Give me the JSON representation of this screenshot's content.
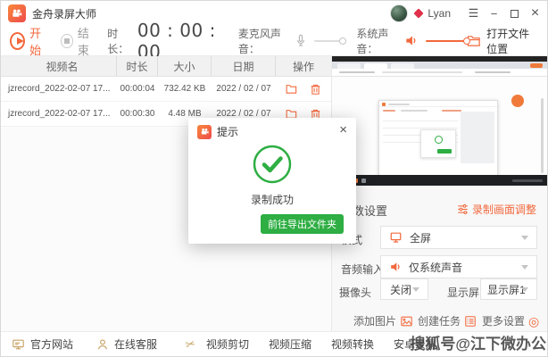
{
  "window": {
    "title": "金舟录屏大师"
  },
  "account": {
    "name": "Lyan"
  },
  "colors": {
    "accent": "#f2683c",
    "green": "#2eae43"
  },
  "toolbar": {
    "start_label": "开始",
    "stop_label": "结束",
    "duration_label": "时长：",
    "timer": "00 : 00 : 00",
    "mic_label": "麦克风声音：",
    "system_label": "系统声音：",
    "open_location_label": "打开文件位置"
  },
  "table": {
    "headers": {
      "name": "视频名",
      "duration": "时长",
      "size": "大小",
      "date": "日期",
      "actions": "操作"
    },
    "rows": [
      {
        "name": "jzrecord_2022-02-07 17...",
        "duration": "00:00:04",
        "size": "732.42 KB",
        "date": "2022 / 02 / 07"
      },
      {
        "name": "jzrecord_2022-02-07 17...",
        "duration": "00:00:30",
        "size": "4.48 MB",
        "date": "2022 / 02 / 07"
      }
    ]
  },
  "dialog": {
    "title": "提示",
    "message": "录制成功",
    "button_label": "前往导出文件夹"
  },
  "settings": {
    "section_title": "参数设置",
    "adjust_label": "录制画面调整",
    "mode_label": "模式",
    "mode_value": "全屏",
    "audio_label": "音频输入",
    "audio_value": "仅系统声音",
    "camera_label": "摄像头",
    "camera_value": "关闭",
    "display_label": "显示屏",
    "display_value": "显示屏1",
    "add_image_label": "添加图片",
    "create_task_label": "创建任务",
    "more_settings_label": "更多设置"
  },
  "footer": {
    "official_site": "官方网站",
    "support": "在线客服",
    "video_cut": "视频剪切",
    "video_compress": "视频压缩",
    "video_convert": "视频转换",
    "android_record": "安卓录屏"
  },
  "watermark": {
    "text": "搜狐号@江下微办公"
  }
}
